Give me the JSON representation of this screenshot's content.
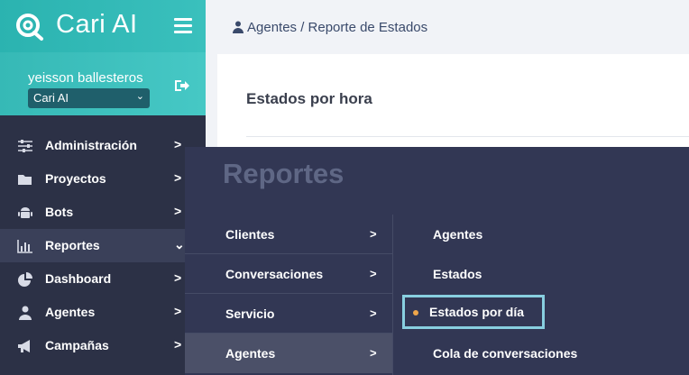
{
  "brand": {
    "name": "Cari AI",
    "logo_icon": "cari-logo-icon"
  },
  "user": {
    "name": "yeisson ballesteros",
    "organization": "Cari AI"
  },
  "sidebar": {
    "items": [
      {
        "label": "Administración",
        "icon": "sliders-icon"
      },
      {
        "label": "Proyectos",
        "icon": "folder-icon"
      },
      {
        "label": "Bots",
        "icon": "android-icon"
      },
      {
        "label": "Reportes",
        "icon": "bar-chart-icon",
        "active": true
      },
      {
        "label": "Dashboard",
        "icon": "pie-chart-icon"
      },
      {
        "label": "Agentes",
        "icon": "user-icon"
      },
      {
        "label": "Campañas",
        "icon": "megaphone-icon"
      }
    ]
  },
  "breadcrumb": {
    "text": "Agentes / Reporte de Estados"
  },
  "card": {
    "title": "Estados por hora"
  },
  "reports_menu": {
    "title": "Reportes",
    "categories": [
      {
        "label": "Clientes"
      },
      {
        "label": "Conversaciones"
      },
      {
        "label": "Servicio"
      },
      {
        "label": "Agentes",
        "active": true
      }
    ],
    "subitems": [
      {
        "label": "Agentes"
      },
      {
        "label": "Estados"
      },
      {
        "label": "Estados por día",
        "highlighted": true
      },
      {
        "label": "Cola de conversaciones"
      }
    ]
  },
  "colors": {
    "brand_teal": "#2bb3b0",
    "sidebar_bg": "#2c3146",
    "menu_bg": "#323754",
    "highlight_border": "#88cfe0",
    "dot": "#f0a64a"
  }
}
